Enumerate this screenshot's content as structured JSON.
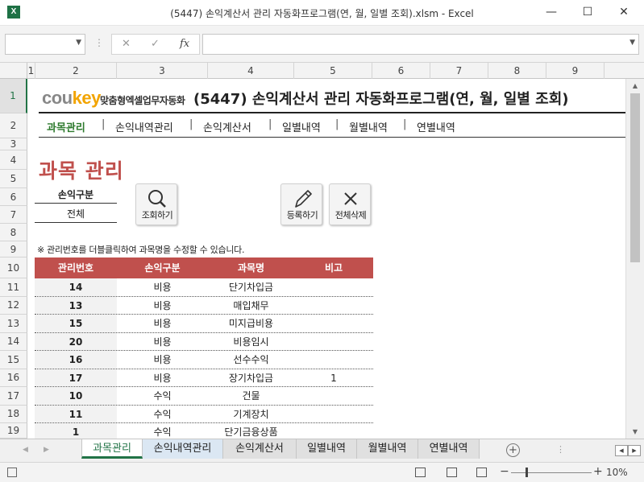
{
  "window": {
    "title": "(5447) 손익계산서 관리 자동화프로그램(연, 월, 일별 조회).xlsm - Excel",
    "app_icon": "X",
    "minimize": "—",
    "maximize": "☐",
    "close": "✕"
  },
  "formula_bar": {
    "cancel": "✕",
    "enter": "✓",
    "fx": "fx"
  },
  "columns": [
    "1",
    "2",
    "3",
    "4",
    "5",
    "6",
    "7",
    "8",
    "9"
  ],
  "rows": [
    "1",
    "2",
    "3",
    "4",
    "5",
    "6",
    "7",
    "8",
    "9",
    "10",
    "11",
    "12",
    "13",
    "14",
    "15",
    "16",
    "17",
    "18",
    "19"
  ],
  "brand": {
    "cou": "cou",
    "key": "key",
    "tagline": "맞춤형엑셀업무자동화",
    "program_title": "(5447) 손익계산서 관리 자동화프로그램(연, 월, 일별 조회)"
  },
  "nav": [
    "과목관리",
    "손익내역관리",
    "손익계산서",
    "일별내역",
    "월별내역",
    "연별내역"
  ],
  "nav_separator": "|",
  "section_title": "과목 관리",
  "filter": {
    "label": "손익구분",
    "value": "전체"
  },
  "buttons": {
    "search": "조회하기",
    "register": "등록하기",
    "delete_all": "전체삭제"
  },
  "note": "※ 관리번호를 더블클릭하여 과목명을 수정할 수 있습니다.",
  "table": {
    "headers": [
      "관리번호",
      "손익구분",
      "과목명",
      "비고"
    ],
    "rows": [
      [
        "14",
        "비용",
        "단기차입금",
        ""
      ],
      [
        "13",
        "비용",
        "매입채무",
        ""
      ],
      [
        "15",
        "비용",
        "미지급비용",
        ""
      ],
      [
        "20",
        "비용",
        "비용임시",
        ""
      ],
      [
        "16",
        "비용",
        "선수수익",
        ""
      ],
      [
        "17",
        "비용",
        "장기차입금",
        "1"
      ],
      [
        "10",
        "수익",
        "건물",
        ""
      ],
      [
        "11",
        "수익",
        "기계장치",
        ""
      ],
      [
        "1",
        "수익",
        "단기금융상품",
        ""
      ]
    ]
  },
  "sheet_tabs": [
    "과목관리",
    "손익내역관리",
    "손익계산서",
    "일별내역",
    "월별내역",
    "연별내역"
  ],
  "status": {
    "zoom": "10%",
    "zoom_minus": "−",
    "zoom_plus": "+",
    "add_sheet": "+"
  },
  "colors": {
    "accent_green": "#217346",
    "header_red": "#c0504d",
    "brand_orange": "#f2a400",
    "nav_active_green": "#2d7a2d"
  }
}
